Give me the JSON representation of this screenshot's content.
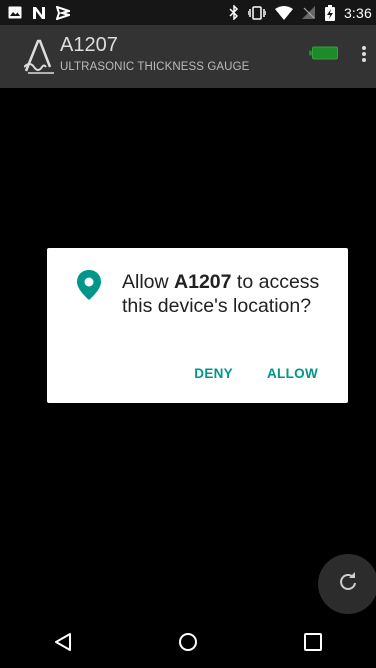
{
  "status_bar": {
    "time": "3:36",
    "left_icons": [
      "image-icon",
      "notification-n-icon",
      "notification-flag-icon"
    ],
    "right_icons": [
      "bluetooth-icon",
      "vibrate-icon",
      "wifi-icon",
      "no-signal-icon",
      "battery-charging-icon"
    ]
  },
  "app_bar": {
    "title": "A1207",
    "subtitle": "ULTRASONIC THICKNESS GAUGE",
    "battery_color": "#1f8a2a"
  },
  "dialog": {
    "message_prefix": "Allow ",
    "app_name": "A1207",
    "message_suffix": " to access this device's location?",
    "deny_label": "DENY",
    "allow_label": "ALLOW",
    "accent_color": "#00968a"
  },
  "fab": {
    "icon": "refresh-icon"
  },
  "nav_bar": {
    "buttons": [
      "back-icon",
      "home-icon",
      "recents-icon"
    ]
  }
}
